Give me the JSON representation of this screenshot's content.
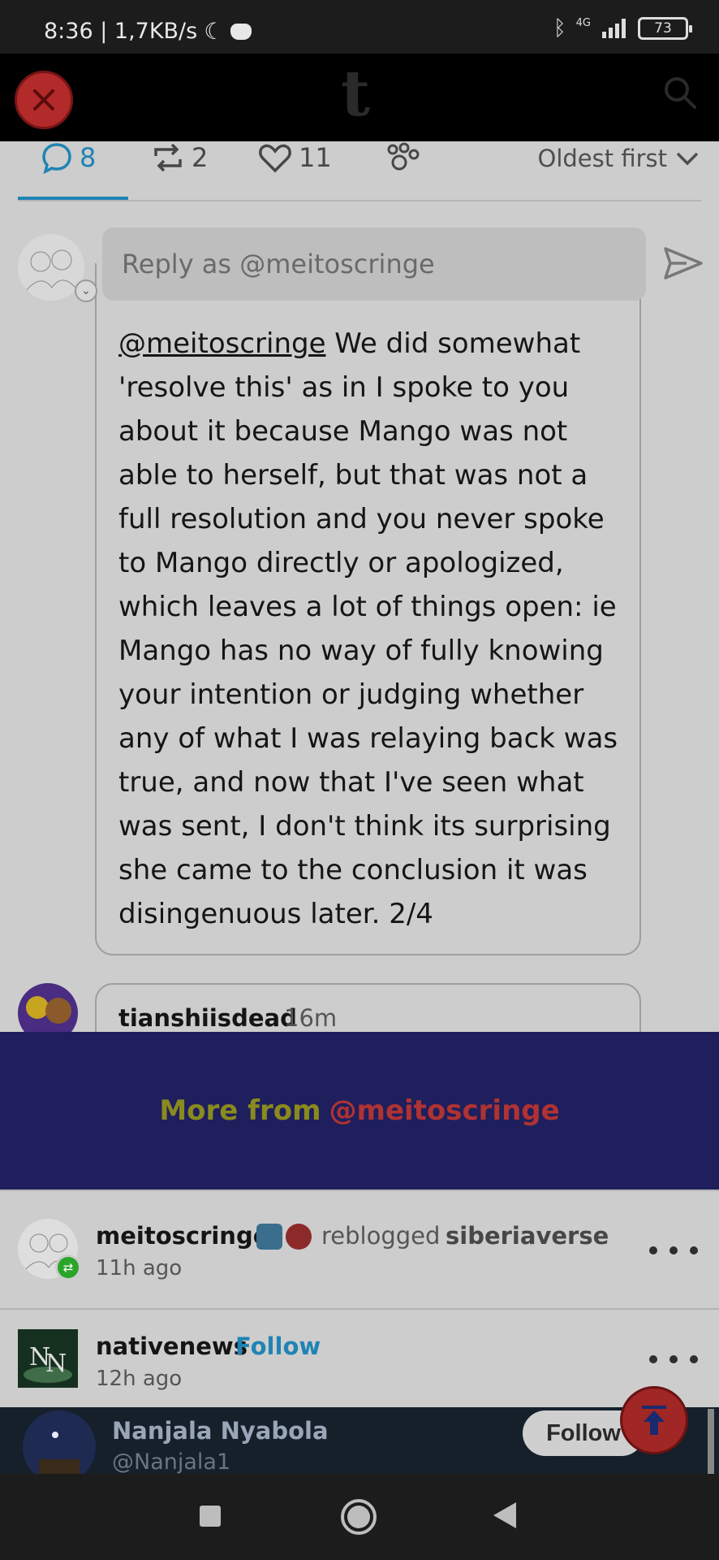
{
  "status_bar": {
    "time_speed": "8:36 | 1,7KB/s",
    "network": "4G",
    "battery": "73"
  },
  "header": {
    "logo": "t",
    "icons": {
      "close": "close-icon",
      "search": "search-icon"
    }
  },
  "tabs": {
    "comments_count": "8",
    "reblogs_count": "2",
    "likes_count": "11",
    "sort_label": "Oldest first"
  },
  "reply": {
    "placeholder": "Reply as @meitoscringe"
  },
  "comment": {
    "mention": "@meitoscringe",
    "body": " We did somewhat 'resolve this' as in I spoke to you about it because Mango was not able to herself, but that was not a full resolution and you never spoke to Mango directly or apologized, which leaves a lot of things open: ie Mango has no way of fully knowing your intention or judging whether any of what I was relaying back was true, and now that I've seen what was sent, I don't think its surprising she came to the conclusion it was disingenuous later. 2/4"
  },
  "next_comment": {
    "username": "tianshiisdead",
    "time": "16m"
  },
  "more_from": {
    "prefix": "More from",
    "user": "@meitoscringe"
  },
  "feed": [
    {
      "username": "meitoscringe",
      "action": "reblogged",
      "source": "siberiaverse",
      "time": "11h ago"
    },
    {
      "username": "nativenews",
      "follow_label": "Follow",
      "time": "12h ago"
    }
  ],
  "embed": {
    "name": "Nanjala Nyabola",
    "handle": "@Nanjala1",
    "follow_label": "Follow"
  },
  "colors": {
    "accent": "#1f84b4",
    "banner_bg": "#1e1f5c",
    "close_red": "#b32a2a"
  }
}
